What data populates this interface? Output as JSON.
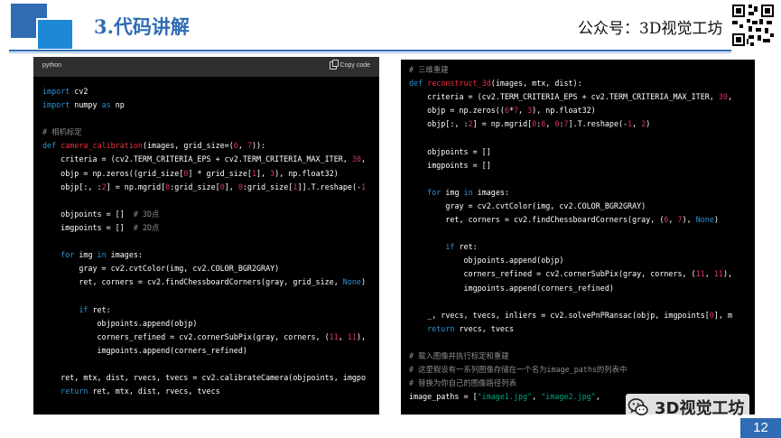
{
  "header": {
    "title": "3.代码讲解",
    "brand": "公众号：3D视觉工坊"
  },
  "left_panel": {
    "language": "python",
    "copy_label": "Copy code",
    "lines": [
      [
        [
          "k",
          "import"
        ],
        [
          "p",
          " cv2"
        ]
      ],
      [
        [
          "k",
          "import"
        ],
        [
          "p",
          " numpy "
        ],
        [
          "k",
          "as"
        ],
        [
          "p",
          " np"
        ]
      ],
      [],
      [
        [
          "c",
          "# 相机标定"
        ]
      ],
      [
        [
          "k",
          "def"
        ],
        [
          "p",
          " "
        ],
        [
          "f",
          "camera_calibration"
        ],
        [
          "p",
          "(images, grid_size=("
        ],
        [
          "n",
          "6"
        ],
        [
          "p",
          ", "
        ],
        [
          "n",
          "7"
        ],
        [
          "p",
          ")):"
        ]
      ],
      [
        [
          "p",
          "    criteria = (cv2.TERM_CRITERIA_EPS + cv2.TERM_CRITERIA_MAX_ITER, "
        ],
        [
          "n",
          "30"
        ],
        [
          "p",
          ","
        ]
      ],
      [
        [
          "p",
          "    objp = np.zeros((grid_size["
        ],
        [
          "n",
          "0"
        ],
        [
          "p",
          "] * grid_size["
        ],
        [
          "n",
          "1"
        ],
        [
          "p",
          "], "
        ],
        [
          "n",
          "3"
        ],
        [
          "p",
          "), np.float32)"
        ]
      ],
      [
        [
          "p",
          "    objp[:, :"
        ],
        [
          "n",
          "2"
        ],
        [
          "p",
          "] = np.mgrid["
        ],
        [
          "n",
          "0"
        ],
        [
          "p",
          ":grid_size["
        ],
        [
          "n",
          "0"
        ],
        [
          "p",
          "], "
        ],
        [
          "n",
          "0"
        ],
        [
          "p",
          ":grid_size["
        ],
        [
          "n",
          "1"
        ],
        [
          "p",
          "]].T.reshape(-"
        ],
        [
          "n",
          "1"
        ]
      ],
      [],
      [
        [
          "p",
          "    objpoints = []  "
        ],
        [
          "c",
          "# 3D点"
        ]
      ],
      [
        [
          "p",
          "    imgpoints = []  "
        ],
        [
          "c",
          "# 2D点"
        ]
      ],
      [],
      [
        [
          "p",
          "    "
        ],
        [
          "k",
          "for"
        ],
        [
          "p",
          " img "
        ],
        [
          "k",
          "in"
        ],
        [
          "p",
          " images:"
        ]
      ],
      [
        [
          "p",
          "        gray = cv2.cvtColor(img, cv2.COLOR_BGR2GRAY)"
        ]
      ],
      [
        [
          "p",
          "        ret, corners = cv2.findChessboardCorners(gray, grid_size, "
        ],
        [
          "k",
          "None"
        ],
        [
          "p",
          ")"
        ]
      ],
      [],
      [
        [
          "p",
          "        "
        ],
        [
          "k",
          "if"
        ],
        [
          "p",
          " ret:"
        ]
      ],
      [
        [
          "p",
          "            objpoints.append(objp)"
        ]
      ],
      [
        [
          "p",
          "            corners_refined = cv2.cornerSubPix(gray, corners, ("
        ],
        [
          "n",
          "11"
        ],
        [
          "p",
          ", "
        ],
        [
          "n",
          "11"
        ],
        [
          "p",
          "),"
        ]
      ],
      [
        [
          "p",
          "            imgpoints.append(corners_refined)"
        ]
      ],
      [],
      [
        [
          "p",
          "    ret, mtx, dist, rvecs, tvecs = cv2.calibrateCamera(objpoints, imgpo"
        ]
      ],
      [
        [
          "p",
          "    "
        ],
        [
          "k",
          "return"
        ],
        [
          "p",
          " ret, mtx, dist, rvecs, tvecs"
        ]
      ]
    ]
  },
  "right_panel": {
    "lines": [
      [
        [
          "c",
          "# 三维重建"
        ]
      ],
      [
        [
          "k",
          "def"
        ],
        [
          "p",
          " "
        ],
        [
          "f",
          "reconstruct_3d"
        ],
        [
          "p",
          "(images, mtx, dist):"
        ]
      ],
      [
        [
          "p",
          "    criteria = (cv2.TERM_CRITERIA_EPS + cv2.TERM_CRITERIA_MAX_ITER, "
        ],
        [
          "n",
          "30"
        ],
        [
          "p",
          ","
        ]
      ],
      [
        [
          "p",
          "    objp = np.zeros(("
        ],
        [
          "n",
          "6"
        ],
        [
          "p",
          "*"
        ],
        [
          "n",
          "7"
        ],
        [
          "p",
          ", "
        ],
        [
          "n",
          "3"
        ],
        [
          "p",
          "), np.float32)"
        ]
      ],
      [
        [
          "p",
          "    objp[:, :"
        ],
        [
          "n",
          "2"
        ],
        [
          "p",
          "] = np.mgrid["
        ],
        [
          "n",
          "0"
        ],
        [
          "p",
          ":"
        ],
        [
          "n",
          "6"
        ],
        [
          "p",
          ", "
        ],
        [
          "n",
          "0"
        ],
        [
          "p",
          ":"
        ],
        [
          "n",
          "7"
        ],
        [
          "p",
          "].T.reshape(-"
        ],
        [
          "n",
          "1"
        ],
        [
          "p",
          ", "
        ],
        [
          "n",
          "2"
        ],
        [
          "p",
          ")"
        ]
      ],
      [],
      [
        [
          "p",
          "    objpoints = []"
        ]
      ],
      [
        [
          "p",
          "    imgpoints = []"
        ]
      ],
      [],
      [
        [
          "p",
          "    "
        ],
        [
          "k",
          "for"
        ],
        [
          "p",
          " img "
        ],
        [
          "k",
          "in"
        ],
        [
          "p",
          " images:"
        ]
      ],
      [
        [
          "p",
          "        gray = cv2.cvtColor(img, cv2.COLOR_BGR2GRAY)"
        ]
      ],
      [
        [
          "p",
          "        ret, corners = cv2.findChessboardCorners(gray, ("
        ],
        [
          "n",
          "6"
        ],
        [
          "p",
          ", "
        ],
        [
          "n",
          "7"
        ],
        [
          "p",
          "), "
        ],
        [
          "k",
          "None"
        ],
        [
          "p",
          ")"
        ]
      ],
      [],
      [
        [
          "p",
          "        "
        ],
        [
          "k",
          "if"
        ],
        [
          "p",
          " ret:"
        ]
      ],
      [
        [
          "p",
          "            objpoints.append(objp)"
        ]
      ],
      [
        [
          "p",
          "            corners_refined = cv2.cornerSubPix(gray, corners, ("
        ],
        [
          "n",
          "11"
        ],
        [
          "p",
          ", "
        ],
        [
          "n",
          "11"
        ],
        [
          "p",
          "),"
        ]
      ],
      [
        [
          "p",
          "            imgpoints.append(corners_refined)"
        ]
      ],
      [],
      [
        [
          "p",
          "    _, rvecs, tvecs, inliers = cv2.solvePnPRansac(objp, imgpoints["
        ],
        [
          "n",
          "0"
        ],
        [
          "p",
          "], m"
        ]
      ],
      [
        [
          "p",
          "    "
        ],
        [
          "k",
          "return"
        ],
        [
          "p",
          " rvecs, tvecs"
        ]
      ],
      [],
      [
        [
          "c",
          "# 载入图像并执行标定和重建"
        ]
      ],
      [
        [
          "c",
          "# 这里假设有一系列图像存储在一个名为image_paths的列表中"
        ]
      ],
      [
        [
          "c",
          "# 替换为你自己的图像路径列表"
        ]
      ],
      [
        [
          "p",
          "image_paths = ["
        ],
        [
          "s",
          "\"image1.jpg\""
        ],
        [
          "p",
          ", "
        ],
        [
          "s",
          "\"image2.jpg\""
        ],
        [
          "p",
          ", "
        ]
      ]
    ]
  },
  "watermark": {
    "text": "3D视觉工坊"
  },
  "page_number": "12",
  "colors": {
    "accent": "#2f6cb3",
    "code_bg": "#000000",
    "keyword": "#2e95d3",
    "function": "#f22c3d",
    "number": "#df3079",
    "comment": "#8c8c8c",
    "string": "#00a67d"
  }
}
